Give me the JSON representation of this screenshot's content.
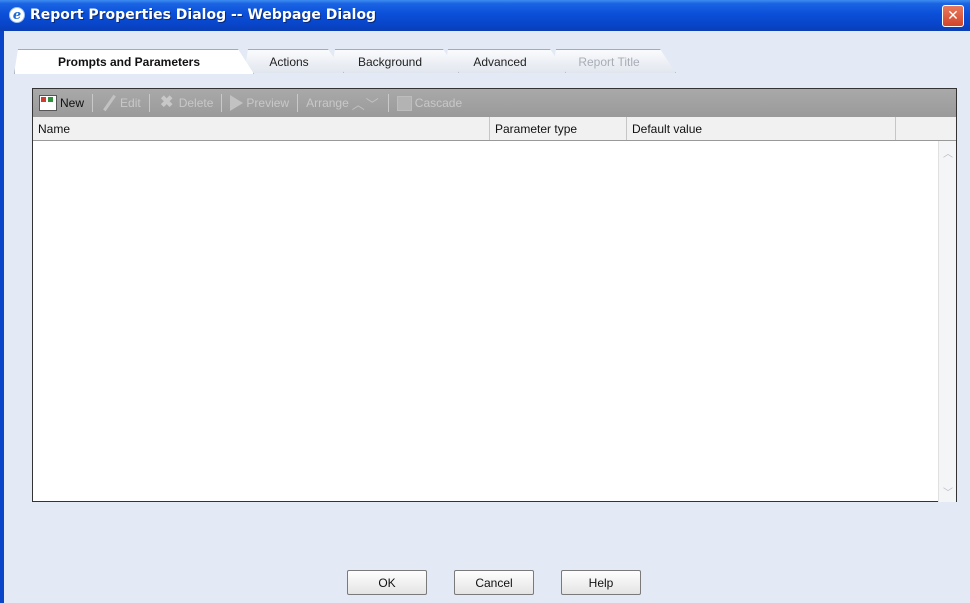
{
  "window": {
    "title": "Report Properties Dialog -- Webpage Dialog",
    "icon": "ie-icon",
    "close_glyph": "✕"
  },
  "tabs": [
    {
      "label": "Prompts and Parameters",
      "state": "active"
    },
    {
      "label": "Actions",
      "state": "normal"
    },
    {
      "label": "Background",
      "state": "normal"
    },
    {
      "label": "Advanced",
      "state": "normal"
    },
    {
      "label": "Report Title",
      "state": "disabled"
    }
  ],
  "toolbar": {
    "new": {
      "label": "New",
      "icon": "new-parameter-icon",
      "enabled": true
    },
    "edit": {
      "label": "Edit",
      "icon": "pencil-icon",
      "enabled": false
    },
    "delete": {
      "label": "Delete",
      "icon": "delete-x-icon",
      "enabled": false
    },
    "preview": {
      "label": "Preview",
      "icon": "play-icon",
      "enabled": false
    },
    "arrange": {
      "label": "Arrange",
      "icon": "up-down-arrows-icon",
      "enabled": false
    },
    "cascade": {
      "label": "Cascade",
      "icon": "cascade-icon",
      "enabled": false
    }
  },
  "grid": {
    "columns": [
      "Name",
      "Parameter type",
      "Default value"
    ],
    "rows": []
  },
  "buttons": {
    "ok": "OK",
    "cancel": "Cancel",
    "help": "Help"
  },
  "colors": {
    "titlebar": "#0b4fd8",
    "panel_bg": "#e3e9f5",
    "toolbar_bg": "#a3a3a3"
  }
}
